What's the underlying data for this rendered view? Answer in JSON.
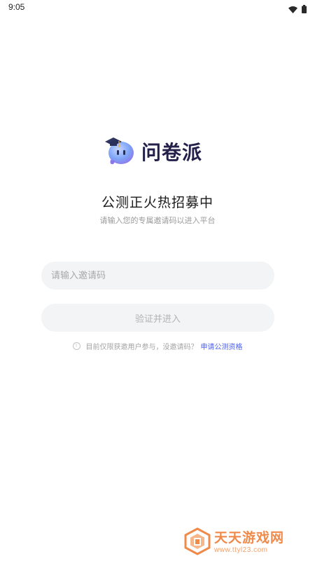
{
  "status_bar": {
    "time": "9:05",
    "icons": [
      "wifi-icon",
      "battery-icon"
    ]
  },
  "logo": {
    "text": "问卷派",
    "icon": "mascot-icon"
  },
  "headline": "公测正火热招募中",
  "subline": "请输入您的专属邀请码以进入平台",
  "invite_input": {
    "placeholder": "请输入邀请码",
    "value": ""
  },
  "verify_button": {
    "label": "验证并进入"
  },
  "notice": {
    "text": "目前仅限获邀用户参与，没邀请码？",
    "link": "申请公测资格",
    "icon": "info-icon"
  },
  "watermark": {
    "title": "天天游戏网",
    "url": "www.ttyl23.com"
  },
  "colors": {
    "accent": "#4a5ff0",
    "logo_text": "#23214a",
    "input_bg": "#f3f4f6",
    "watermark": "#f08a4b"
  }
}
